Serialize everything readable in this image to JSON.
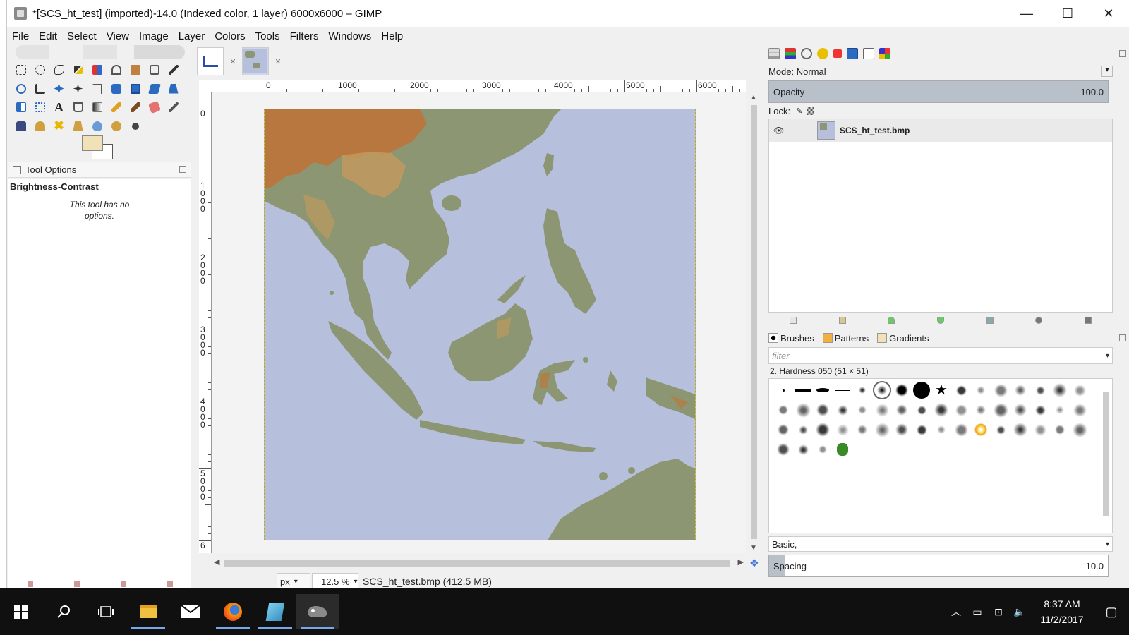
{
  "window": {
    "title": "*[SCS_ht_test] (imported)-14.0 (Indexed color, 1 layer) 6000x6000 – GIMP",
    "minimize": "—",
    "maximize": "☐",
    "close": "✕"
  },
  "menu": [
    "File",
    "Edit",
    "Select",
    "View",
    "Image",
    "Layer",
    "Colors",
    "Tools",
    "Filters",
    "Windows",
    "Help"
  ],
  "toolbox": {
    "colors": {
      "fg": "#f0e2b6",
      "bg": "#ffffff"
    },
    "tool_options_label": "Tool Options",
    "active_tool": "Brightness-Contrast",
    "tool_message": "This tool has no options."
  },
  "image_tabs": [
    {
      "name": "tab-1"
    },
    {
      "name": "SCS_ht_test",
      "active": true
    }
  ],
  "ruler": {
    "h_labels": [
      "0",
      "1000",
      "2000",
      "3000",
      "4000",
      "5000",
      "6000"
    ],
    "v_labels": [
      "0",
      "1000",
      "2000",
      "3000",
      "4000",
      "5000",
      "6"
    ]
  },
  "status": {
    "unit": "px",
    "zoom": "12.5 %",
    "file_info": "SCS_ht_test.bmp (412.5 MB)"
  },
  "layers": {
    "mode_label": "Mode: Normal",
    "opacity_label": "Opacity",
    "opacity_value": "100.0",
    "lock_label": "Lock:",
    "items": [
      {
        "name": "SCS_ht_test.bmp",
        "visible": true
      }
    ]
  },
  "brushes": {
    "tabs": [
      "Brushes",
      "Patterns",
      "Gradients"
    ],
    "filter_placeholder": "filter",
    "selected_brush": "2. Hardness 050 (51 × 51)",
    "preset": "Basic,",
    "spacing_label": "Spacing",
    "spacing_value": "10.0"
  },
  "taskbar": {
    "time": "8:37 AM",
    "date": "11/2/2017"
  },
  "map_colors": {
    "sea": "#b6bfdc",
    "land": "#8c9672",
    "high": "#b8773f",
    "mid": "#c49a5c"
  }
}
